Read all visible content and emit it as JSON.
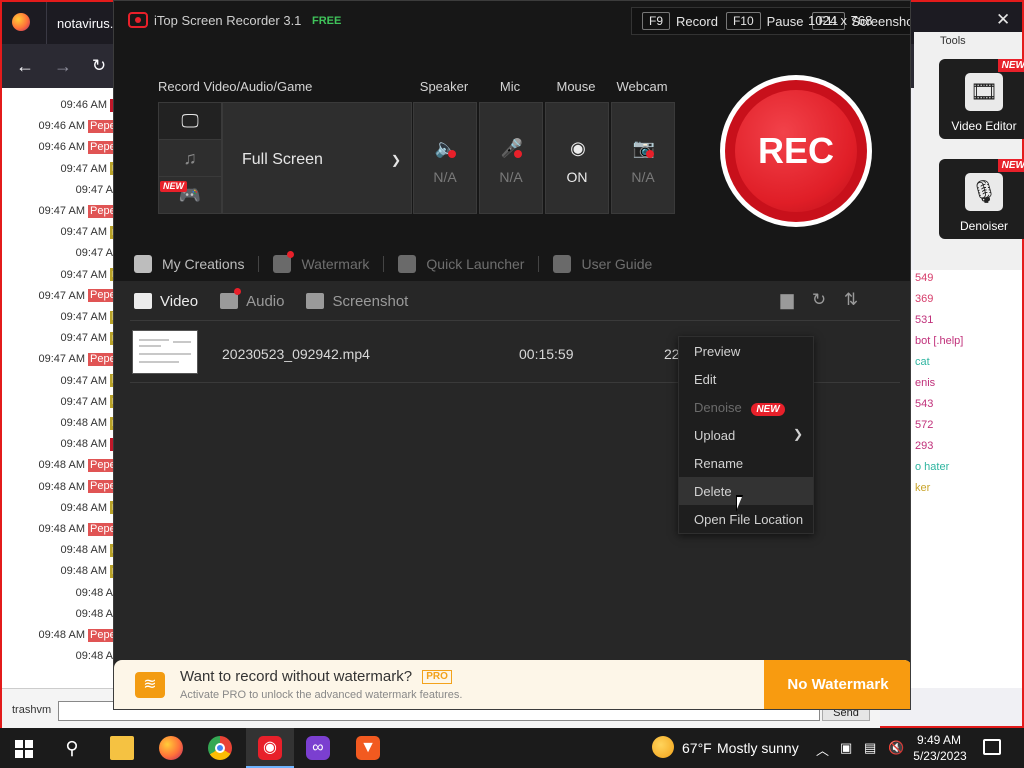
{
  "browser": {
    "tab_title": "notavirus.c",
    "back_icon": "arrow-left-icon",
    "forward_icon": "arrow-right-icon",
    "reload_icon": "reload-icon"
  },
  "chat_left": {
    "rows": [
      {
        "time": "09:46 AM",
        "badge": "",
        "color": "#c0182a"
      },
      {
        "time": "09:46 AM",
        "badge": "Pepe",
        "color": "#e05454"
      },
      {
        "time": "09:46 AM",
        "badge": "Pepe",
        "color": "#e05454"
      },
      {
        "time": "09:47 AM",
        "badge": "n",
        "color": "#b9a32a"
      },
      {
        "time": "09:47 A",
        "badge": "",
        "color": ""
      },
      {
        "time": "09:47 AM",
        "badge": "Pepe",
        "color": "#e05454"
      },
      {
        "time": "09:47 AM",
        "badge": "n",
        "color": "#b9a32a"
      },
      {
        "time": "09:47 A",
        "badge": "",
        "color": ""
      },
      {
        "time": "09:47 AM",
        "badge": "n",
        "color": "#b9a32a"
      },
      {
        "time": "09:47 AM",
        "badge": "Pepe",
        "color": "#e05454"
      },
      {
        "time": "09:47 AM",
        "badge": "b",
        "color": "#b9a32a"
      },
      {
        "time": "09:47 AM",
        "badge": "n",
        "color": "#b9a32a"
      },
      {
        "time": "09:47 AM",
        "badge": "Pepe",
        "color": "#e05454"
      },
      {
        "time": "09:47 AM",
        "badge": "b",
        "color": "#b9a32a"
      },
      {
        "time": "09:47 AM",
        "badge": "n",
        "color": "#b9a32a"
      },
      {
        "time": "09:48 AM",
        "badge": "n",
        "color": "#b9a32a"
      },
      {
        "time": "09:48 AM",
        "badge": "",
        "color": "#c0182a"
      },
      {
        "time": "09:48 AM",
        "badge": "Pepe",
        "color": "#e05454"
      },
      {
        "time": "09:48 AM",
        "badge": "Pepe",
        "color": "#e05454"
      },
      {
        "time": "09:48 AM",
        "badge": "n",
        "color": "#b9a32a"
      },
      {
        "time": "09:48 AM",
        "badge": "Pepe",
        "color": "#e05454"
      },
      {
        "time": "09:48 AM",
        "badge": "n",
        "color": "#b9a32a"
      },
      {
        "time": "09:48 AM",
        "badge": "n",
        "color": "#b9a32a"
      },
      {
        "time": "09:48 A",
        "badge": "",
        "color": ""
      },
      {
        "time": "09:48 A",
        "badge": "",
        "color": ""
      },
      {
        "time": "09:48 AM",
        "badge": "Pepe",
        "color": "#e05454"
      },
      {
        "time": "09:48 A",
        "badge": "",
        "color": ""
      }
    ],
    "input_user": "trashvm",
    "send_label": "Send"
  },
  "chat_right": {
    "rows": [
      {
        "text": "549",
        "color": "#d63c6a"
      },
      {
        "text": "369",
        "color": "#d63c6a"
      },
      {
        "text": "531",
        "color": "#c0307a"
      },
      {
        "text": "bot [.help]",
        "color": "#c0307a"
      },
      {
        "text": "cat",
        "color": "#2fb5a0"
      },
      {
        "text": "enis",
        "color": "#c0307a"
      },
      {
        "text": "543",
        "color": "#c0307a"
      },
      {
        "text": "572",
        "color": "#c0307a"
      },
      {
        "text": "293",
        "color": "#c0307a"
      },
      {
        "text": "o hater",
        "color": "#2fb5a0"
      },
      {
        "text": "ker",
        "color": "#c9a42a"
      }
    ]
  },
  "tools": {
    "title": "Tools",
    "items": [
      {
        "label": "Video Editor",
        "badge": "NEW",
        "icon": "film-edit-icon"
      },
      {
        "label": "Denoiser",
        "badge": "NEW",
        "icon": "microphone-wave-icon"
      }
    ]
  },
  "app": {
    "title": "iTop Screen Recorder 3.1",
    "badge": "FREE",
    "hotkeys": [
      {
        "key": "F9",
        "label": "Record"
      },
      {
        "key": "F10",
        "label": "Pause"
      },
      {
        "key": "F11",
        "label": "Screenshot"
      }
    ],
    "resolution": "1024 x 768",
    "close_icon": "close-icon"
  },
  "record": {
    "section_label": "Record Video/Audio/Game",
    "modes": [
      {
        "name": "screen",
        "icon": "monitor-icon"
      },
      {
        "name": "audio",
        "icon": "music-note-icon"
      },
      {
        "name": "game",
        "icon": "gamepad-icon",
        "badge": "NEW"
      }
    ],
    "area": "Full Screen",
    "devices": [
      {
        "label": "Speaker",
        "state": "N/A",
        "icon": "speaker-icon",
        "on": false
      },
      {
        "label": "Mic",
        "state": "N/A",
        "icon": "microphone-icon",
        "on": false
      },
      {
        "label": "Mouse",
        "state": "ON",
        "icon": "mouse-click-icon",
        "on": true
      },
      {
        "label": "Webcam",
        "state": "N/A",
        "icon": "webcam-icon",
        "on": false
      }
    ],
    "rec_label": "REC"
  },
  "quicknav": [
    {
      "label": "My Creations",
      "icon": "creations-icon"
    },
    {
      "label": "Watermark",
      "icon": "watermark-icon"
    },
    {
      "label": "Quick Launcher",
      "icon": "launcher-icon"
    },
    {
      "label": "User Guide",
      "icon": "guide-icon"
    }
  ],
  "tabs": [
    {
      "label": "Video",
      "icon": "video-icon"
    },
    {
      "label": "Audio",
      "icon": "music-icon"
    },
    {
      "label": "Screenshot",
      "icon": "image-icon"
    }
  ],
  "tab_actions": [
    "folder-icon",
    "refresh-icon",
    "sort-icon"
  ],
  "file": {
    "name": "20230523_092942.mp4",
    "duration": "00:15:59",
    "date": "22"
  },
  "context_menu": {
    "items": [
      {
        "label": "Preview",
        "disabled": false
      },
      {
        "label": "Edit",
        "disabled": false
      },
      {
        "label": "Denoise",
        "disabled": true,
        "badge": "NEW"
      },
      {
        "label": "Upload",
        "disabled": false,
        "submenu": true
      },
      {
        "label": "Rename",
        "disabled": false
      },
      {
        "label": "Delete",
        "disabled": false,
        "hover": true
      },
      {
        "label": "Open File Location",
        "disabled": false
      }
    ]
  },
  "promo": {
    "title": "Want to record without watermark?",
    "pro_badge": "PRO",
    "subtitle": "Activate PRO to unlock the advanced watermark features.",
    "button": "No Watermark"
  },
  "taskbar": {
    "weather_temp": "67°F",
    "weather_cond": "Mostly sunny",
    "time": "9:49 AM",
    "date": "5/23/2023"
  }
}
